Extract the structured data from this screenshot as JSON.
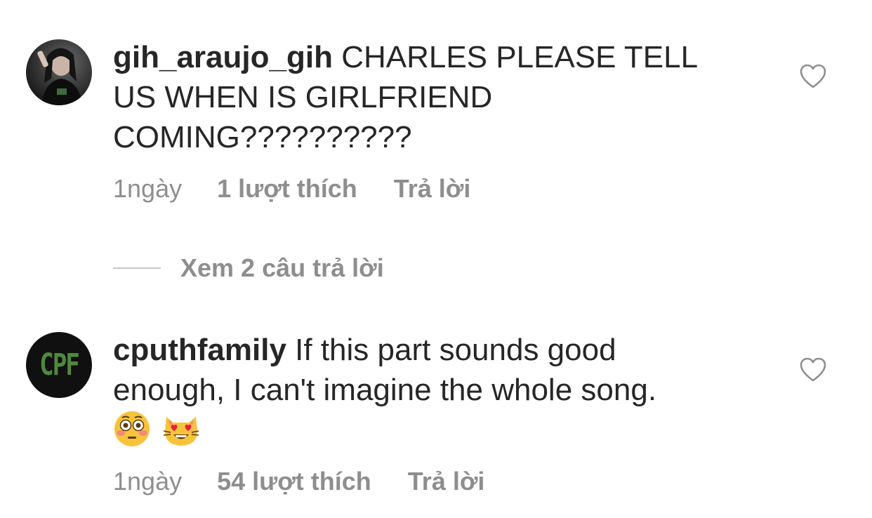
{
  "comments": [
    {
      "username": "gih_araujo_gih",
      "text": "CHARLES PLEASE TELL US WHEN IS GIRLFRIEND COMING??????????",
      "emojis": [],
      "time": "1ngày",
      "likes": "1 lượt thích",
      "reply": "Trả lời",
      "avatar": "profile-photo"
    },
    {
      "username": "cputhfamily",
      "text": "If this part sounds good enough, I can't imagine the whole song.",
      "emojis": [
        "flushed-face",
        "smiling-cat-heart-eyes"
      ],
      "time": "1ngày",
      "likes": "54 lượt thích",
      "reply": "Trả lời",
      "avatar_text": "CPF"
    }
  ],
  "view_replies": "Xem 2 câu trả lời",
  "icons": {
    "like": "heart-outline-icon"
  },
  "colors": {
    "text": "#262626",
    "secondary": "#8e8e8e",
    "logo_green": "#4f8a3c"
  }
}
